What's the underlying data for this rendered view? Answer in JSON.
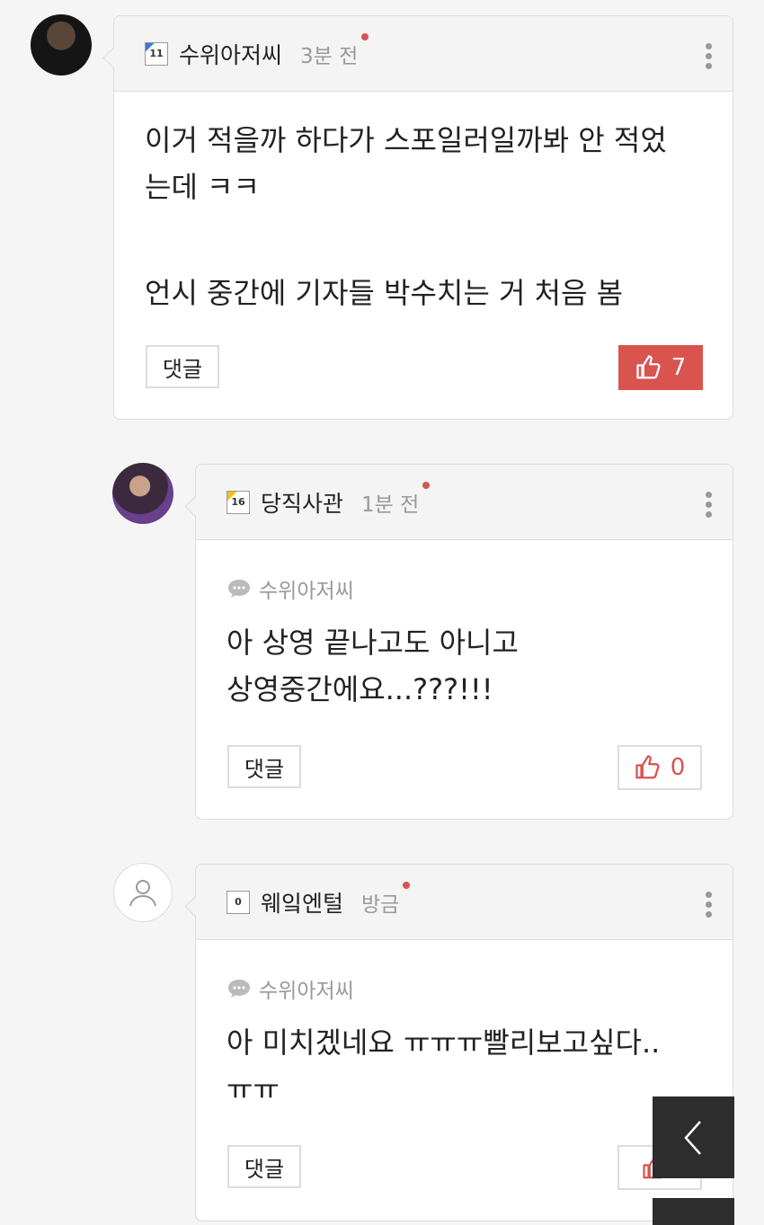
{
  "comments": [
    {
      "author": "수위아저씨",
      "level": "11",
      "time": "3분 전",
      "body": [
        "이거 적을까 하다가 스포일러일까봐 안 적었",
        "는데 ㅋㅋ",
        "",
        "언시 중간에 기자들 박수치는 거 처음 봄"
      ],
      "reply_label": "댓글",
      "likes": "7",
      "liked": true
    },
    {
      "author": "당직사관",
      "level": "16",
      "time": "1분 전",
      "reply_to": "수위아저씨",
      "body": [
        "아 상영 끝나고도 아니고",
        "상영중간에요...???!!!"
      ],
      "reply_label": "댓글",
      "likes": "0",
      "liked": false
    },
    {
      "author": "웨잌엔털",
      "level": "0",
      "time": "방금",
      "reply_to": "수위아저씨",
      "body": [
        "아 미치겠네요 ㅠㅠㅠ빨리보고싶다..",
        "ㅠㅠ"
      ],
      "reply_label": "댓글",
      "likes": "",
      "liked": false
    }
  ],
  "colors": {
    "like_active": "#d9534f",
    "accent_dot": "#d9534f",
    "float_button": "#2d2d2d"
  },
  "icons": [
    "kebab-icon",
    "thumbs-up-icon",
    "speech-bubble-icon",
    "user-icon",
    "chevron-left-icon"
  ]
}
